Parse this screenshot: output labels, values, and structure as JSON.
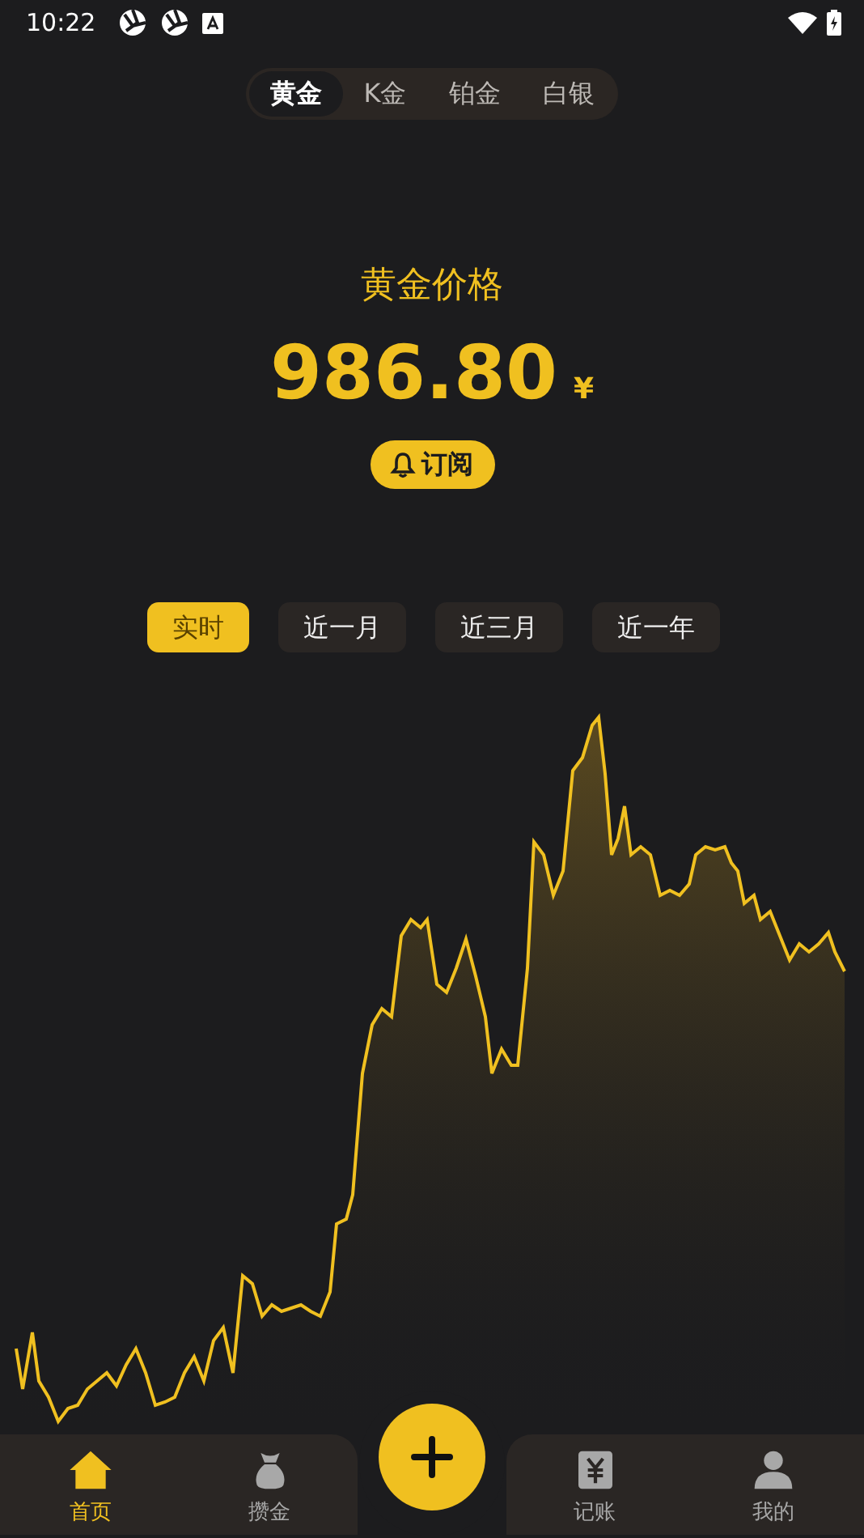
{
  "status_bar": {
    "time": "10:22"
  },
  "metal_tabs": [
    {
      "label": "黄金",
      "selected": true
    },
    {
      "label": "K金",
      "selected": false
    },
    {
      "label": "铂金",
      "selected": false
    },
    {
      "label": "白银",
      "selected": false
    }
  ],
  "price": {
    "title": "黄金价格",
    "value": "986.80",
    "currency": "¥",
    "subscribe": "订阅"
  },
  "periods": [
    {
      "label": "实时",
      "selected": true
    },
    {
      "label": "近一月",
      "selected": false
    },
    {
      "label": "近三月",
      "selected": false
    },
    {
      "label": "近一年",
      "selected": false
    }
  ],
  "nav": [
    {
      "kind": "home",
      "label": "首页",
      "selected": true
    },
    {
      "kind": "bag",
      "label": "攒金",
      "selected": false
    },
    {
      "kind": "ledger",
      "label": "记账",
      "selected": false
    },
    {
      "kind": "user",
      "label": "我的",
      "selected": false
    }
  ]
}
